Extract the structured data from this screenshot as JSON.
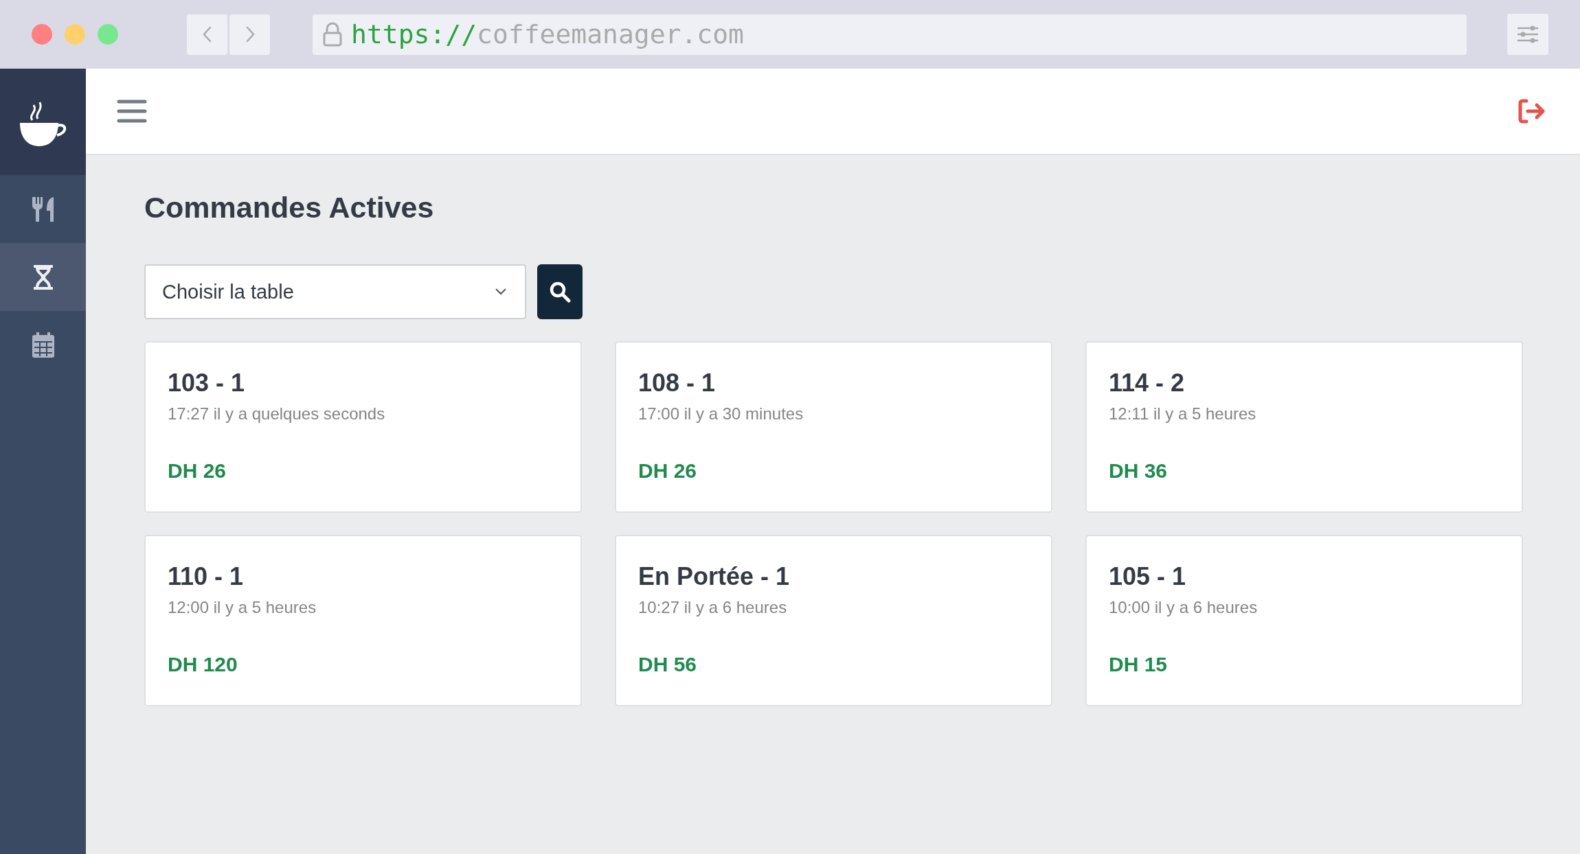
{
  "browser": {
    "url_scheme": "https://",
    "url_host": "coffeemanager.com"
  },
  "sidebar": {
    "items": [
      {
        "kind": "menu",
        "selected": false
      },
      {
        "kind": "orders",
        "selected": true
      },
      {
        "kind": "calendar",
        "selected": false
      }
    ]
  },
  "page": {
    "title": "Commandes Actives"
  },
  "table_select": {
    "placeholder": "Choisir la table"
  },
  "orders": [
    {
      "name": "103 - 1",
      "time": "17:27 il y a quelques seconds",
      "total": "DH 26"
    },
    {
      "name": "108 - 1",
      "time": "17:00 il y a 30 minutes",
      "total": "DH 26"
    },
    {
      "name": "114 - 2",
      "time": "12:11 il y a 5 heures",
      "total": "DH 36"
    },
    {
      "name": "110 - 1",
      "time": "12:00 il y a 5 heures",
      "total": "DH 120"
    },
    {
      "name": "En Portée - 1",
      "time": "10:27 il y a 6 heures",
      "total": "DH 56"
    },
    {
      "name": "105 - 1",
      "time": "10:00 il y a 6 heures",
      "total": "DH 15"
    }
  ]
}
